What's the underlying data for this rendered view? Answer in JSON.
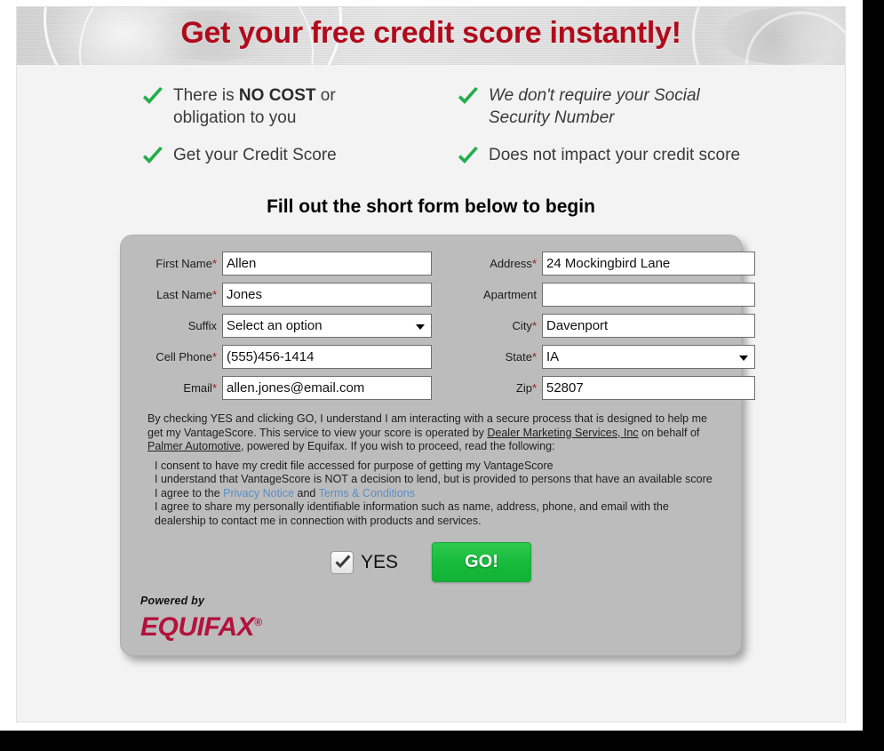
{
  "header": {
    "title": "Get your free credit score instantly!",
    "title_color": "#b00b1c"
  },
  "benefits": [
    {
      "text_prefix": "There is ",
      "text_bold": "NO COST",
      "text_suffix": " or obligation to you",
      "italic": false,
      "icon": "check-icon"
    },
    {
      "text_prefix": "Get your Credit Score",
      "text_bold": "",
      "text_suffix": "",
      "italic": false,
      "icon": "check-icon"
    },
    {
      "text_prefix": "We don't require your Social Security Number",
      "text_bold": "",
      "text_suffix": "",
      "italic": true,
      "icon": "check-icon"
    },
    {
      "text_prefix": "Does not impact your credit score",
      "text_bold": "",
      "text_suffix": "",
      "italic": false,
      "icon": "check-icon"
    }
  ],
  "form": {
    "heading": "Fill out the short form below to begin",
    "fields": {
      "first_name": {
        "label": "First Name",
        "required_mark": "*",
        "value": "Allen",
        "type": "text"
      },
      "last_name": {
        "label": "Last Name",
        "required_mark": "*",
        "value": "Jones",
        "type": "text"
      },
      "suffix": {
        "label": "Suffix",
        "required_mark": "",
        "value": "Select an option",
        "type": "select"
      },
      "cell_phone": {
        "label": "Cell Phone",
        "required_mark": "*",
        "value": "(555)456-1414",
        "type": "text"
      },
      "email": {
        "label": "Email",
        "required_mark": "*",
        "value": "allen.jones@email.com",
        "type": "text"
      },
      "address": {
        "label": "Address",
        "required_mark": "*",
        "value": "24 Mockingbird Lane",
        "type": "text"
      },
      "apartment": {
        "label": "Apartment",
        "required_mark": "",
        "value": "",
        "type": "text"
      },
      "city": {
        "label": "City",
        "required_mark": "*",
        "value": "Davenport",
        "type": "text"
      },
      "state": {
        "label": "State",
        "required_mark": "*",
        "value": "IA",
        "type": "select"
      },
      "zip": {
        "label": "Zip",
        "required_mark": "*",
        "value": "52807",
        "type": "text"
      }
    }
  },
  "disclosure": {
    "part1": "By checking YES and clicking GO, I understand I am interacting with a secure process that is designed to help me get my VantageScore. This service to view your score is operated by ",
    "link1": "Dealer Marketing Services, Inc",
    "part2": " on behalf of ",
    "link2": "Palmer Automotive",
    "part3": ", powered by Equifax. If you wish to proceed, read the following:"
  },
  "consent": {
    "line1": "I consent to have my credit file accessed for purpose of getting my VantageScore",
    "line2": "I understand that VantageScore is NOT a decision to lend, but is provided to persons that have an available score",
    "line3_prefix": "I agree to the ",
    "line3_link1": "Privacy Notice",
    "line3_mid": " and ",
    "line3_link2": "Terms & Conditions",
    "line4": "I agree to share my personally identifiable information such as name, address, phone, and email with the dealership to contact me in connection with products and services.",
    "link_color": "#5a8fc8"
  },
  "actions": {
    "yes_label": "YES",
    "yes_checked": true,
    "go_label": "GO!",
    "go_color": "#17bb3c"
  },
  "footer": {
    "powered_by": "Powered by",
    "brand": "EQUIFAX",
    "registered_mark": "®",
    "brand_color": "#b3123c"
  }
}
